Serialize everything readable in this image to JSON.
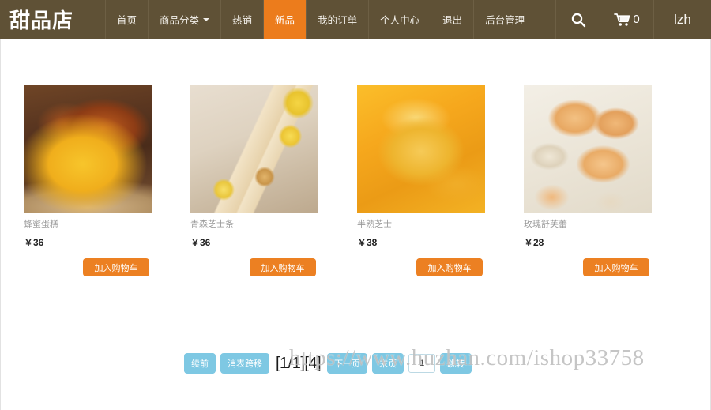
{
  "navbar": {
    "brand": "甜品店",
    "links": [
      {
        "label": "首页",
        "active": false,
        "has_caret": false
      },
      {
        "label": "商品分类",
        "active": false,
        "has_caret": true
      },
      {
        "label": "热销",
        "active": false,
        "has_caret": false
      },
      {
        "label": "新品",
        "active": true,
        "has_caret": false
      },
      {
        "label": "我的订单",
        "active": false,
        "has_caret": false
      },
      {
        "label": "个人中心",
        "active": false,
        "has_caret": false
      },
      {
        "label": "退出",
        "active": false,
        "has_caret": false
      },
      {
        "label": "后台管理",
        "active": false,
        "has_caret": false
      }
    ],
    "search_icon": "search-icon",
    "cart_icon": "shopping-cart-icon",
    "cart_count": "0",
    "username": "lzh",
    "bg_color": "#5f5136",
    "active_color": "#ec7c1c"
  },
  "products": [
    {
      "name": "蜂蜜蛋糕",
      "price": "￥36",
      "add_to_cart_label": "加入购物车",
      "image_alt": "honey-sponge-cake"
    },
    {
      "name": "青森芝士条",
      "price": "￥36",
      "add_to_cart_label": "加入购物车",
      "image_alt": "aomori-cheese-bars-with-lemon"
    },
    {
      "name": "半熟芝士",
      "price": "￥38",
      "add_to_cart_label": "加入购物车",
      "image_alt": "half-baked-cheese-tart"
    },
    {
      "name": "玫瑰舒芙蕾",
      "price": "￥28",
      "add_to_cart_label": "加入购物车",
      "image_alt": "rose-souffle-macarons"
    }
  ],
  "pagination": {
    "prev_label": "续前",
    "first_label": "消表跨移",
    "page_info": "[1/1][4]",
    "next_label": "下一页",
    "last_label": "末页",
    "goto_label": "跳转",
    "page_input_value": "1",
    "button_color": "#7ec8e3"
  },
  "watermark": {
    "text": "https://www.huzhan.com/ishop33758"
  }
}
